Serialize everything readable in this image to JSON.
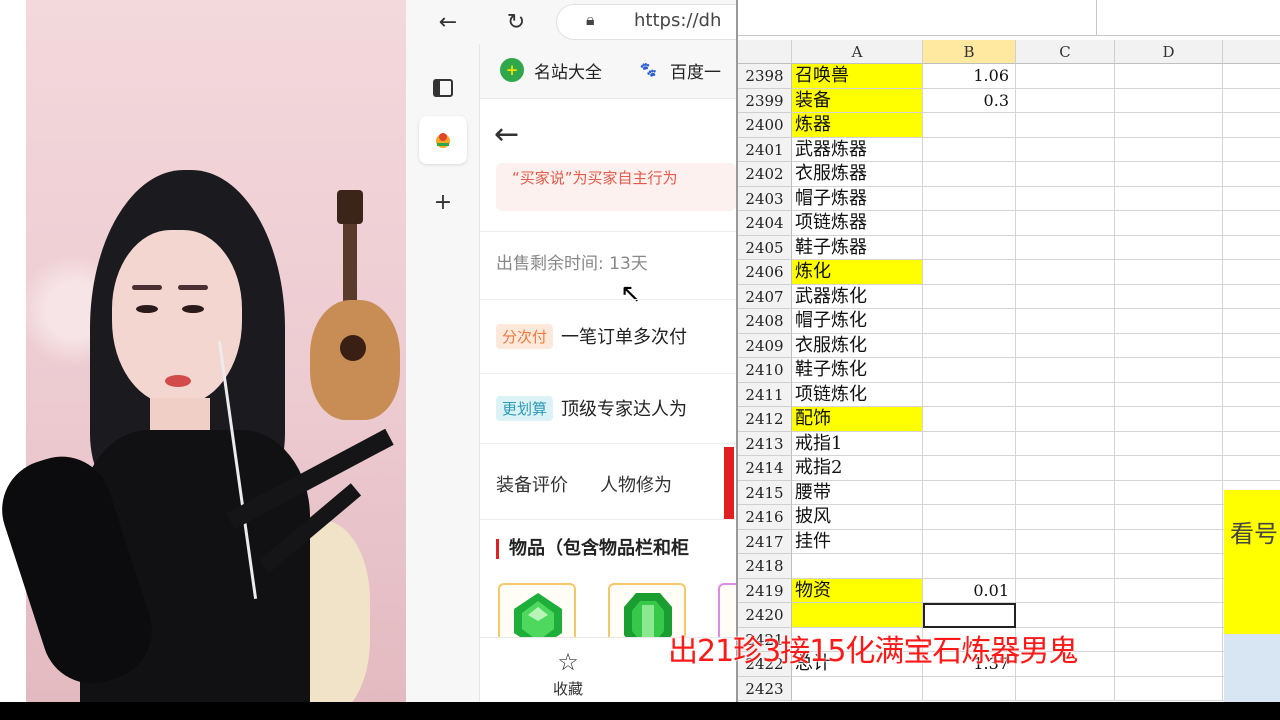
{
  "browser": {
    "url": "https://dh",
    "bookmarks": [
      {
        "label": "名站大全",
        "icon": "plus-circle-icon",
        "color": "#2ea84a"
      },
      {
        "label": "百度一",
        "icon": "paw-icon",
        "color": "#2a5bd7"
      }
    ],
    "page": {
      "notice": "“买家说”为买家自主行为",
      "remaining_time": "出售剩余时间: 13天",
      "tag1": {
        "label": "分次付",
        "text": "一笔订单多次付",
        "bg": "#fde9dc",
        "fg": "#f07a3a"
      },
      "tag2": {
        "label": "更划算",
        "text": "顶级专家达人为",
        "bg": "#ddf2f6",
        "fg": "#2a9bb8"
      },
      "tabs": [
        "装备评价",
        "人物修为"
      ],
      "section_title": "物品（包含物品栏和柜",
      "favorite_label": "收藏"
    }
  },
  "sheet": {
    "columns": [
      "A",
      "B",
      "C",
      "D"
    ],
    "rows": [
      {
        "n": "2398",
        "a": "召唤兽",
        "b": "1.06",
        "hl": true
      },
      {
        "n": "2399",
        "a": "装备",
        "b": "0.3",
        "hl": true
      },
      {
        "n": "2400",
        "a": "炼器",
        "b": "",
        "hl": true
      },
      {
        "n": "2401",
        "a": "武器炼器",
        "b": "",
        "hl": false
      },
      {
        "n": "2402",
        "a": "衣服炼器",
        "b": "",
        "hl": false
      },
      {
        "n": "2403",
        "a": "帽子炼器",
        "b": "",
        "hl": false
      },
      {
        "n": "2404",
        "a": "项链炼器",
        "b": "",
        "hl": false
      },
      {
        "n": "2405",
        "a": "鞋子炼器",
        "b": "",
        "hl": false
      },
      {
        "n": "2406",
        "a": "炼化",
        "b": "",
        "hl": true
      },
      {
        "n": "2407",
        "a": "武器炼化",
        "b": "",
        "hl": false
      },
      {
        "n": "2408",
        "a": "帽子炼化",
        "b": "",
        "hl": false
      },
      {
        "n": "2409",
        "a": "衣服炼化",
        "b": "",
        "hl": false
      },
      {
        "n": "2410",
        "a": "鞋子炼化",
        "b": "",
        "hl": false
      },
      {
        "n": "2411",
        "a": "项链炼化",
        "b": "",
        "hl": false
      },
      {
        "n": "2412",
        "a": "配饰",
        "b": "",
        "hl": true
      },
      {
        "n": "2413",
        "a": "戒指1",
        "b": "",
        "hl": false
      },
      {
        "n": "2414",
        "a": "戒指2",
        "b": "",
        "hl": false
      },
      {
        "n": "2415",
        "a": "腰带",
        "b": "",
        "hl": false
      },
      {
        "n": "2416",
        "a": "披风",
        "b": "",
        "hl": false
      },
      {
        "n": "2417",
        "a": "挂件",
        "b": "",
        "hl": false
      },
      {
        "n": "2418",
        "a": "",
        "b": "",
        "hl": false
      },
      {
        "n": "2419",
        "a": "物资",
        "b": "0.01",
        "hl": true
      },
      {
        "n": "2420",
        "a": "",
        "b": "",
        "hl": true
      },
      {
        "n": "2421",
        "a": "",
        "b": "",
        "hl": false
      },
      {
        "n": "2422",
        "a": "总计",
        "b": "1.37",
        "hl": false
      },
      {
        "n": "2423",
        "a": "",
        "b": "",
        "hl": false
      }
    ],
    "side_label": "看号",
    "highlight_color": "#ffff00"
  },
  "caption": "出21珍3接15化满宝石炼器男鬼"
}
